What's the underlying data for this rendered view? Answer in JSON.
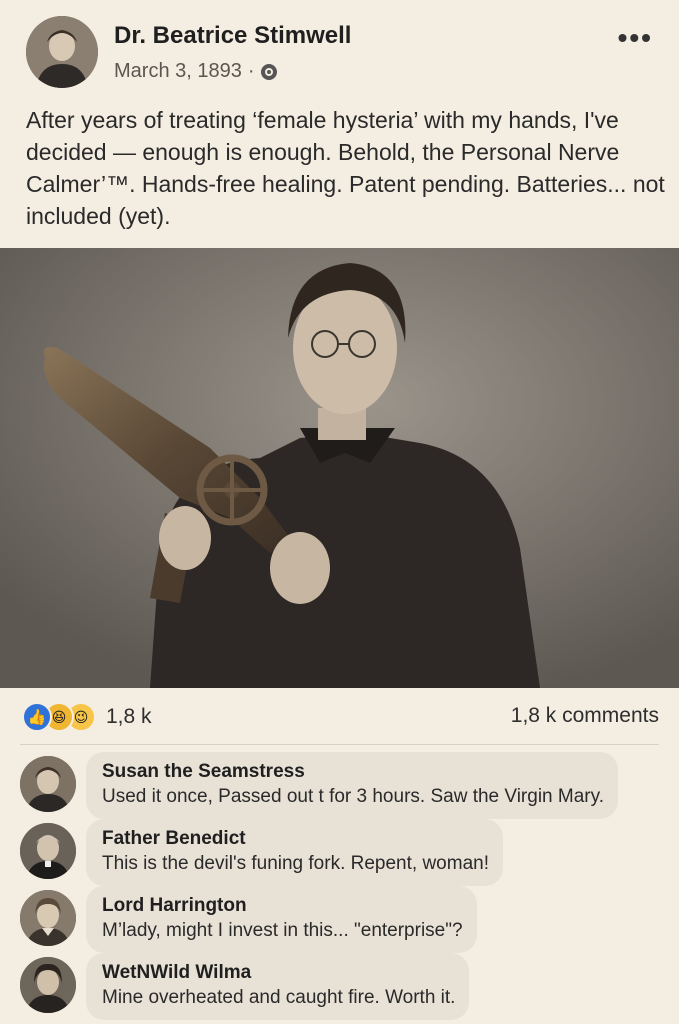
{
  "post": {
    "author": "Dr. Beatrice Stimwell",
    "date": "March 3, 1893",
    "separator": "·",
    "more_icon": "more-horizontal-icon",
    "body": "After years of treating ‘female hysteria’ with my hands, I've decided — enough is enough. Behold, the Personal Nerve Calmer’™. Hands-free healing. Patent pending. Batteries... not included (yet)."
  },
  "photo": {
    "kind": "sepia portrait of a woman holding a brass device"
  },
  "reactions": {
    "icons": [
      "like-icon",
      "haha-icon",
      "wow-icon"
    ],
    "count": "1,8 k",
    "comments": "1,8 k comments"
  },
  "comments": [
    {
      "name": "Susan the Seamstress",
      "text": "Used it once, Passed out t for 3 hours. Saw the Virgin Mary."
    },
    {
      "name": "Father Benedict",
      "text": "This is the devil's funing fork. Repent, woman!"
    },
    {
      "name": "Lord Harrington",
      "text": "M’lady, might I invest in this... \"enterprise\"?"
    },
    {
      "name": "WetNWild Wilma",
      "text": "Mine overheated and caught fire. Worth it."
    }
  ]
}
